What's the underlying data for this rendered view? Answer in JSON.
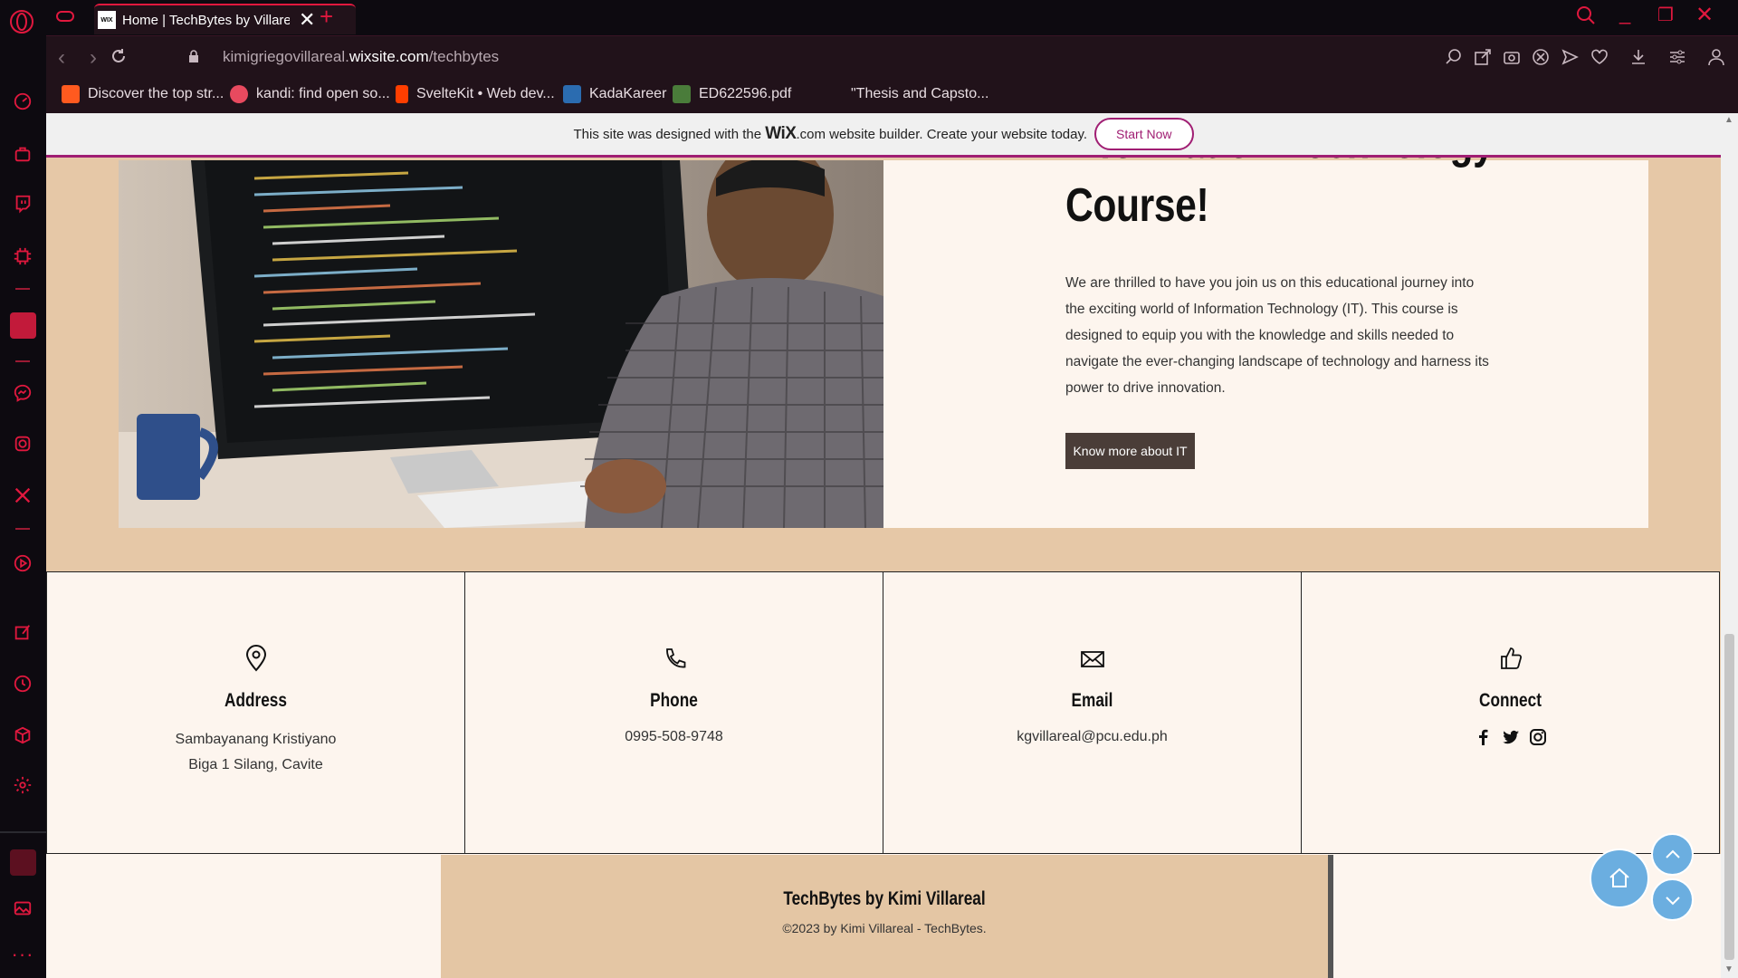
{
  "browser": {
    "tab_title": "Home | TechBytes by Villareal",
    "favicon_text": "WIX",
    "url_prefix": "kimigriegovillareal.",
    "url_domain": "wixsite.com",
    "url_path": "/techbytes"
  },
  "bookmarks": [
    {
      "label": "Discover the top str...",
      "color": "#ff5a1f"
    },
    {
      "label": "kandi: find open so...",
      "color": "#e84a5f"
    },
    {
      "label": "SvelteKit • Web dev...",
      "color": "#ff3e00"
    },
    {
      "label": "KadaKareer",
      "color": "#2b6cb0"
    },
    {
      "label": "ED622596.pdf",
      "color": "#4a7c3a"
    },
    {
      "label": "\"Thesis and Capsto...",
      "color": "#21121a"
    }
  ],
  "wix_banner": {
    "prefix": "This site was designed with the",
    "logo": "WiX",
    "suffix": ".com website builder. Create your website today.",
    "cta": "Start Now"
  },
  "hero": {
    "title_line1": "Information Technology",
    "title_line2": "Course!",
    "body": "We are thrilled to have you join us on this educational journey into the exciting world of Information Technology (IT). This course is designed to equip you with the knowledge and skills needed to navigate the ever-changing landscape of technology and harness its power to drive innovation.",
    "button": "Know more about IT"
  },
  "contact": {
    "address_title": "Address",
    "address_line1": "Sambayanang Kristiyano",
    "address_line2": "Biga 1 Silang, Cavite",
    "phone_title": "Phone",
    "phone": "0995-508-9748",
    "email_title": "Email",
    "email": "kgvillareal@pcu.edu.ph",
    "connect_title": "Connect"
  },
  "footer": {
    "title": "TechBytes by Kimi Villareal",
    "copyright": "©2023 by Kimi Villareal - TechBytes."
  },
  "colors": {
    "accent": "#e0183e",
    "wix_purple": "#a01e73",
    "page_bg": "#e6c8a7",
    "card_bg": "#fdf5ee",
    "button_bg": "#4a3d38",
    "fab": "#6baee0"
  }
}
